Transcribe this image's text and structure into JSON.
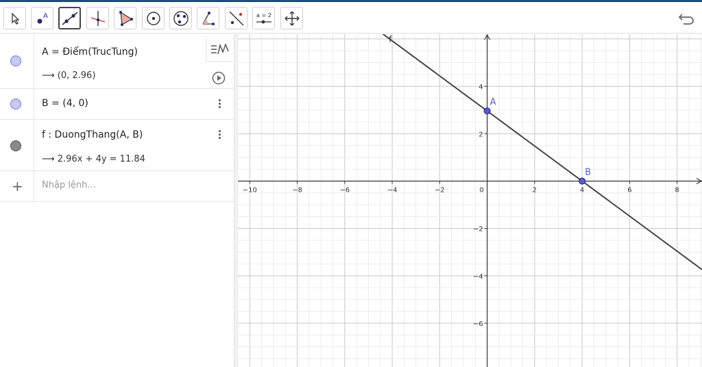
{
  "toolbar": {
    "tools": [
      {
        "name": "move-tool-icon"
      },
      {
        "name": "point-tool-icon"
      },
      {
        "name": "line-tool-icon"
      },
      {
        "name": "perpendicular-line-tool-icon"
      },
      {
        "name": "polygon-tool-icon"
      },
      {
        "name": "circle-center-point-tool-icon"
      },
      {
        "name": "circle-three-points-tool-icon"
      },
      {
        "name": "angle-tool-icon"
      },
      {
        "name": "reflect-tool-icon"
      },
      {
        "name": "slider-tool-icon",
        "label": "a = 2"
      },
      {
        "name": "move-graphics-view-tool-icon"
      }
    ],
    "active_tool": 2
  },
  "algebra": {
    "rows": [
      {
        "definition": "A  =  Điểm(TrucTung)",
        "value": "⟶  (0, 2.96)",
        "color": "#c8c8f4",
        "border": "#7a7ad8"
      },
      {
        "definition": "B  =  (4, 0)",
        "color": "#c8c8f4",
        "border": "#7a7ad8"
      },
      {
        "definition": "f : DuongThang(A, B)",
        "value": "⟶  2.96x  +  4y  =  11.84",
        "color": "#8a8a8a",
        "border": "#555555"
      }
    ],
    "input_placeholder": "Nhập lệnh..."
  },
  "graph": {
    "x_range": [
      -10.5,
      9.05
    ],
    "y_range": [
      -7.85,
      6.2
    ],
    "x_ticks": [
      "−10",
      "−8",
      "−6",
      "−4",
      "−2",
      "0",
      "2",
      "4",
      "6",
      "8"
    ],
    "y_ticks": [
      "4",
      "2",
      "−2",
      "−4",
      "−6"
    ],
    "points": [
      {
        "label": "A",
        "x": 0,
        "y": 2.96
      },
      {
        "label": "B",
        "x": 4,
        "y": 0
      }
    ],
    "line_label": "f",
    "point_color": "#5b5bd6",
    "line_color": "#444444"
  }
}
